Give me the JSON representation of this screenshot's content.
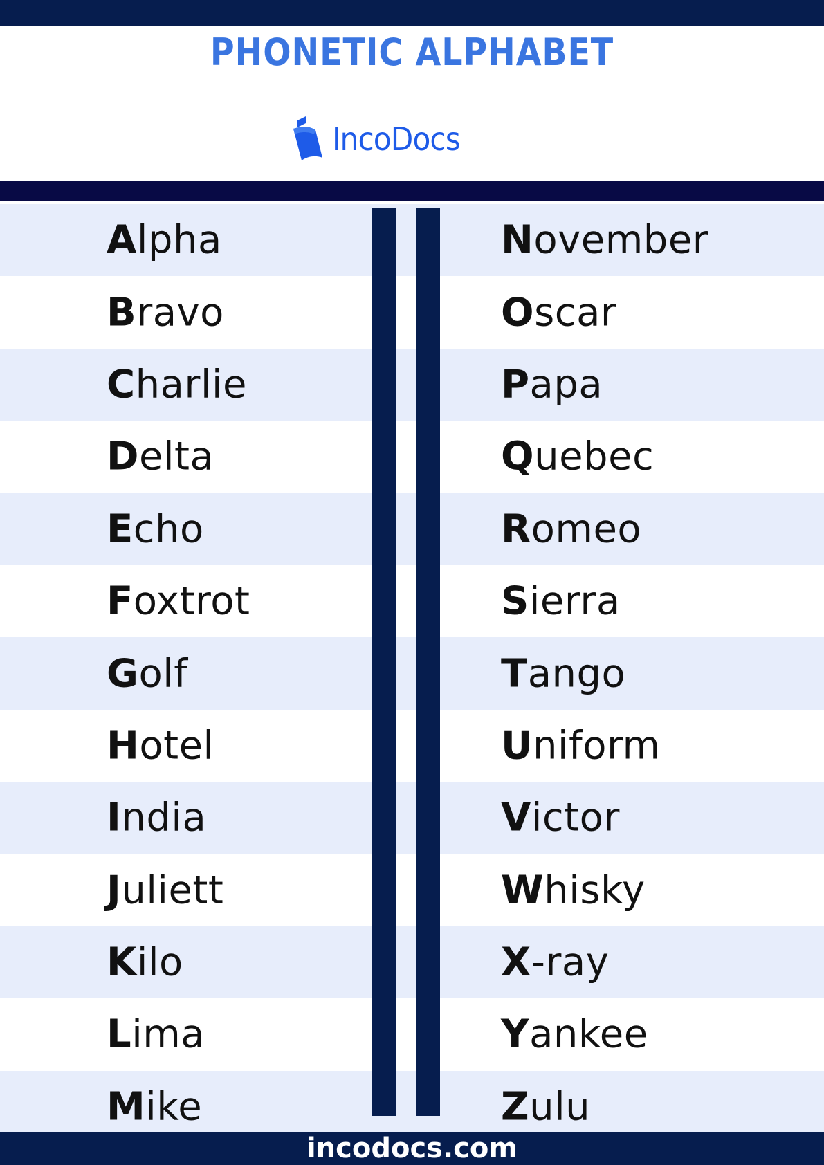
{
  "header": {
    "title": "PHONETIC ALPHABET",
    "logo_text": "IncoDocs",
    "logo_icon": "incodocs-logo-icon"
  },
  "colors": {
    "navy": "#061d4e",
    "title_blue": "#3a75e0",
    "logo_blue": "#1e5be8",
    "row_tint": "#e7edfb"
  },
  "left_column": [
    {
      "initial": "A",
      "rest": "lpha"
    },
    {
      "initial": "B",
      "rest": "ravo"
    },
    {
      "initial": "C",
      "rest": "harlie"
    },
    {
      "initial": "D",
      "rest": "elta"
    },
    {
      "initial": "E",
      "rest": "cho"
    },
    {
      "initial": "F",
      "rest": "oxtrot"
    },
    {
      "initial": "G",
      "rest": "olf"
    },
    {
      "initial": "H",
      "rest": "otel"
    },
    {
      "initial": "I",
      "rest": "ndia"
    },
    {
      "initial": "J",
      "rest": "uliett"
    },
    {
      "initial": "K",
      "rest": "ilo"
    },
    {
      "initial": "L",
      "rest": "ima"
    },
    {
      "initial": "M",
      "rest": "ike"
    }
  ],
  "right_column": [
    {
      "initial": "N",
      "rest": "ovember"
    },
    {
      "initial": "O",
      "rest": "scar"
    },
    {
      "initial": "P",
      "rest": "apa"
    },
    {
      "initial": "Q",
      "rest": "uebec"
    },
    {
      "initial": "R",
      "rest": "omeo"
    },
    {
      "initial": "S",
      "rest": "ierra"
    },
    {
      "initial": "T",
      "rest": "ango"
    },
    {
      "initial": "U",
      "rest": "niform"
    },
    {
      "initial": "V",
      "rest": "ictor"
    },
    {
      "initial": "W",
      "rest": "hisky"
    },
    {
      "initial": "X",
      "rest": "-ray"
    },
    {
      "initial": "Y",
      "rest": "ankee"
    },
    {
      "initial": "Z",
      "rest": "ulu"
    }
  ],
  "footer": {
    "website": "incodocs.com"
  }
}
